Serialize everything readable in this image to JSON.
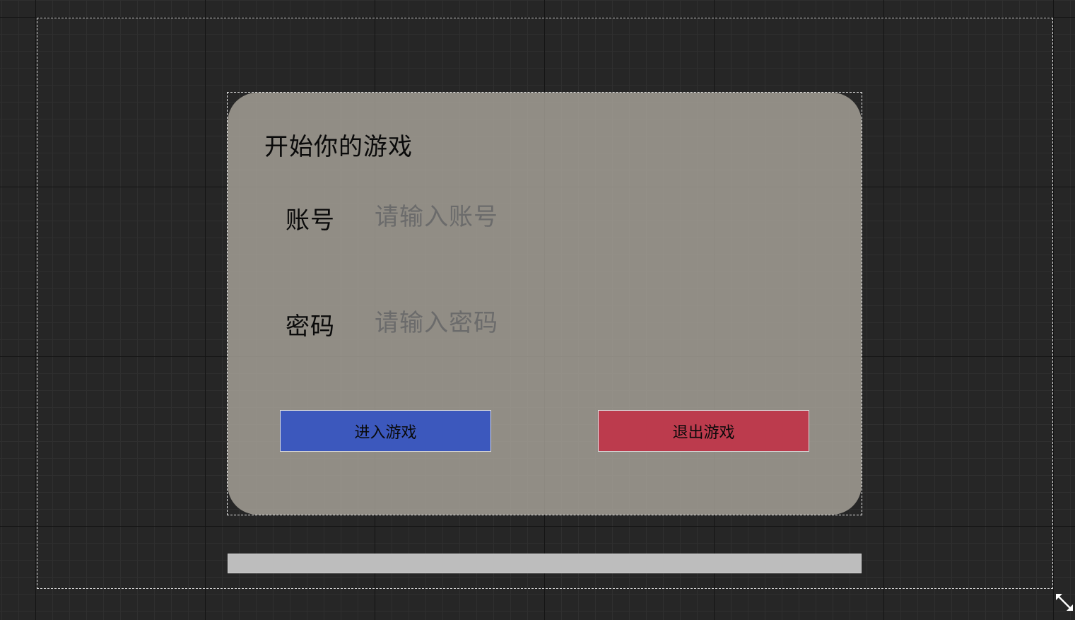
{
  "panel": {
    "title": "开始你的游戏"
  },
  "form": {
    "account_label": "账号",
    "account_placeholder": "请输入账号",
    "account_value": "",
    "password_label": "密码",
    "password_placeholder": "请输入密码",
    "password_value": ""
  },
  "buttons": {
    "enter_label": "进入游戏",
    "exit_label": "退出游戏"
  },
  "progress": {
    "value": 1.0
  },
  "colors": {
    "enter_button": "#3c58bd",
    "exit_button": "#bc3b4d",
    "panel_background": "#b0aaa0",
    "canvas_background": "#262626"
  },
  "icons": {
    "resize": "resize-diagonal-icon"
  }
}
